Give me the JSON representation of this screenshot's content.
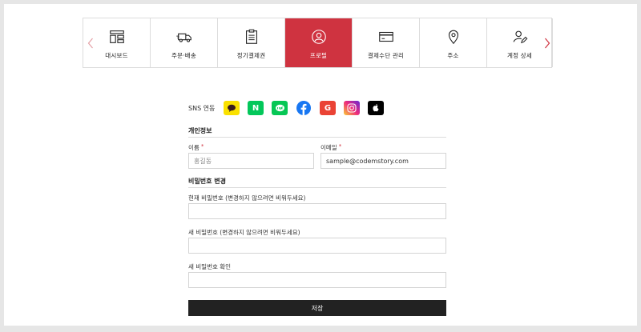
{
  "nav": {
    "tabs": [
      {
        "label": "대시보드",
        "icon": "dashboard-icon",
        "active": false
      },
      {
        "label": "주문·배송",
        "icon": "delivery-truck-icon",
        "active": false
      },
      {
        "label": "정기결제권",
        "icon": "clipboard-icon",
        "active": false
      },
      {
        "label": "프로필",
        "icon": "profile-icon",
        "active": true
      },
      {
        "label": "결제수단 관리",
        "icon": "credit-card-icon",
        "active": false
      },
      {
        "label": "주소",
        "icon": "map-pin-icon",
        "active": false
      },
      {
        "label": "계정 상세",
        "icon": "account-edit-icon",
        "active": false
      }
    ],
    "active_color": "#cf3340"
  },
  "sns": {
    "label": "SNS 연동",
    "providers": [
      {
        "name": "kakao-icon",
        "color": "#fae100"
      },
      {
        "name": "naver-icon",
        "color": "#03c75a",
        "glyph": "N"
      },
      {
        "name": "line-icon",
        "color": "#06c755"
      },
      {
        "name": "facebook-icon",
        "color": "#1877f2"
      },
      {
        "name": "google-icon",
        "color": "#ea4335",
        "glyph": "G"
      },
      {
        "name": "instagram-icon",
        "color": "#d6249f"
      },
      {
        "name": "apple-icon",
        "color": "#000000"
      }
    ]
  },
  "personal": {
    "title": "개인정보",
    "name_label": "이름",
    "name_placeholder": "홍길동",
    "email_label": "이메일",
    "email_value": "sample@codemstory.com",
    "required_mark": "*"
  },
  "password": {
    "title": "비밀번호 변경",
    "current_label": "현재 비밀번호 (변경하지 않으려면 비워두세요)",
    "new_label": "새 비밀번호 (변경하지 않으려면 비워두세요)",
    "confirm_label": "새 비밀번호 확인"
  },
  "save_label": "저장"
}
